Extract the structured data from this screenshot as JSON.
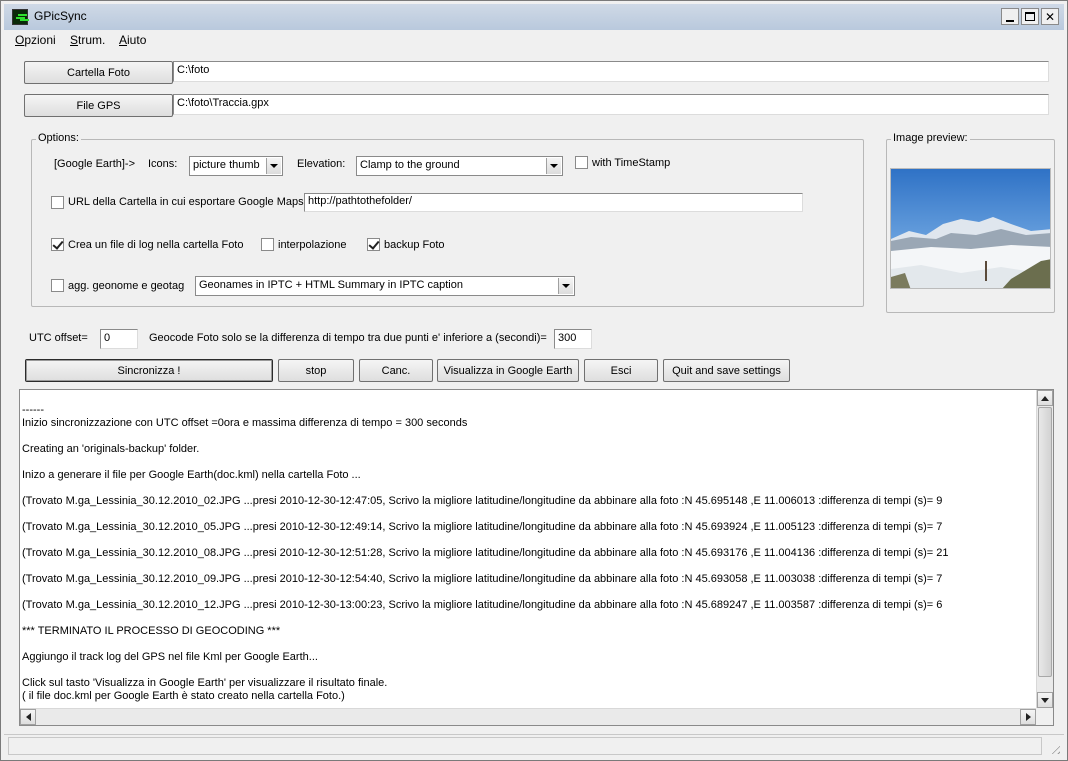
{
  "window": {
    "title": "GPicSync"
  },
  "menu": [
    "Opzioni",
    "Strum.",
    "Aiuto"
  ],
  "paths": {
    "photo_folder_button": "Cartella Foto",
    "photo_folder_value": "C:\\foto",
    "gps_file_button": "File GPS",
    "gps_file_value": "C:\\foto\\Traccia.gpx"
  },
  "options": {
    "legend": "Options:",
    "google_earth_label": "[Google Earth]->",
    "icons_label": "Icons:",
    "icons_value": "picture thumb",
    "elevation_label": "Elevation:",
    "elevation_value": "Clamp to the ground",
    "timestamp_label": "with TimeStamp",
    "timestamp_checked": false,
    "gmaps_url_label": "URL della Cartella in cui esportare Google Maps=",
    "gmaps_url_checked": false,
    "gmaps_url_value": "http://pathtothefolder/",
    "log_file_label": "Crea un file di log nella cartella Foto",
    "log_file_checked": true,
    "interpolation_label": "interpolazione",
    "interpolation_checked": false,
    "backup_label": "backup Foto",
    "backup_checked": true,
    "geonames_label": "agg. geonome e geotag",
    "geonames_checked": false,
    "geonames_value": "Geonames in IPTC + HTML Summary in IPTC caption"
  },
  "preview": {
    "legend": "Image preview:"
  },
  "utc": {
    "label": "UTC offset=",
    "value": "0",
    "geocode_label": "Geocode Foto solo se la differenza di tempo tra due punti e' inferiore a (secondi)=",
    "geocode_value": "300"
  },
  "actions": {
    "sync": "Sincronizza !",
    "stop": "stop",
    "cancel": "Canc.",
    "view_ge": "Visualizza in Google Earth",
    "exit": "Esci",
    "quit_save": "Quit and save settings"
  },
  "log": [
    {
      "text": "------",
      "gap": false
    },
    {
      "text": "Inizio sincronizzazione con UTC offset =0ora e massima differenza di tempo = 300 seconds",
      "gap": true
    },
    {
      "text": "Creating an 'originals-backup' folder.",
      "gap": true
    },
    {
      "text": "Inizo a generare il file per Google Earth(doc.kml) nella cartella Foto ...",
      "gap": true
    },
    {
      "text": "(Trovato M.ga_Lessinia_30.12.2010_02.JPG ...presi 2010-12-30-12:47:05, Scrivo la migliore latitudine/longitudine da abbinare alla foto :N 45.695148 ,E 11.006013 :differenza di tempi (s)= 9",
      "gap": true
    },
    {
      "text": "(Trovato M.ga_Lessinia_30.12.2010_05.JPG ...presi 2010-12-30-12:49:14, Scrivo la migliore latitudine/longitudine da abbinare alla foto :N 45.693924 ,E 11.005123 :differenza di tempi (s)= 7",
      "gap": true
    },
    {
      "text": "(Trovato M.ga_Lessinia_30.12.2010_08.JPG ...presi 2010-12-30-12:51:28, Scrivo la migliore latitudine/longitudine da abbinare alla foto :N 45.693176 ,E 11.004136 :differenza di tempi (s)= 21",
      "gap": true
    },
    {
      "text": "(Trovato M.ga_Lessinia_30.12.2010_09.JPG ...presi 2010-12-30-12:54:40, Scrivo la migliore latitudine/longitudine da abbinare alla foto :N 45.693058 ,E 11.003038 :differenza di tempi (s)= 7",
      "gap": true
    },
    {
      "text": "(Trovato M.ga_Lessinia_30.12.2010_12.JPG ...presi 2010-12-30-13:00:23, Scrivo la migliore latitudine/longitudine da abbinare alla foto :N 45.689247 ,E 11.003587 :differenza di tempi (s)= 6",
      "gap": true
    },
    {
      "text": "*** TERMINATO IL PROCESSO DI GEOCODING ***",
      "gap": true
    },
    {
      "text": "Aggiungo il track log del GPS nel file Kml per Google Earth...",
      "gap": true
    },
    {
      "text": "Click sul tasto 'Visualizza in Google Earth' per visualizzare il risultato finale.",
      "gap": false
    },
    {
      "text": "( il file doc.kml per Google Earth è stato creato nella cartella Foto.)",
      "gap": false
    }
  ]
}
